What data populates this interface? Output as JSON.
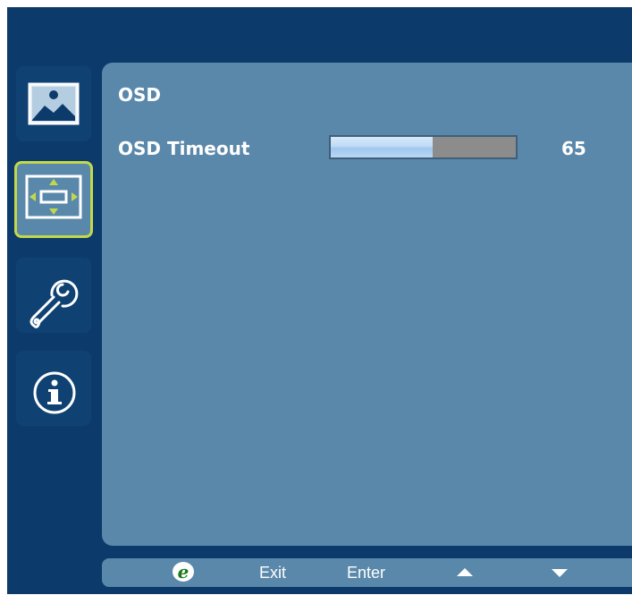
{
  "sidebar": {
    "items": [
      {
        "id": "picture",
        "icon": "picture-icon",
        "active": false
      },
      {
        "id": "osd",
        "icon": "osd-position-icon",
        "active": true
      },
      {
        "id": "settings",
        "icon": "wrench-settings-icon",
        "active": false
      },
      {
        "id": "information",
        "icon": "info-icon",
        "active": false
      }
    ]
  },
  "main": {
    "section_title": "OSD",
    "settings": [
      {
        "label": "OSD Timeout",
        "value": "65",
        "level": 0.55
      }
    ]
  },
  "controls": {
    "e_icon": "e-key-icon",
    "exit_label": "Exit",
    "enter_label": "Enter",
    "up_icon": "up-arrow-icon",
    "down_icon": "down-arrow-icon"
  },
  "colors": {
    "frame": "#0c3a6b",
    "panel": "#5a88ab",
    "active_border": "#c2d84a",
    "e_green": "#1a7a1a",
    "slider_empty": "#8c8c8c"
  }
}
